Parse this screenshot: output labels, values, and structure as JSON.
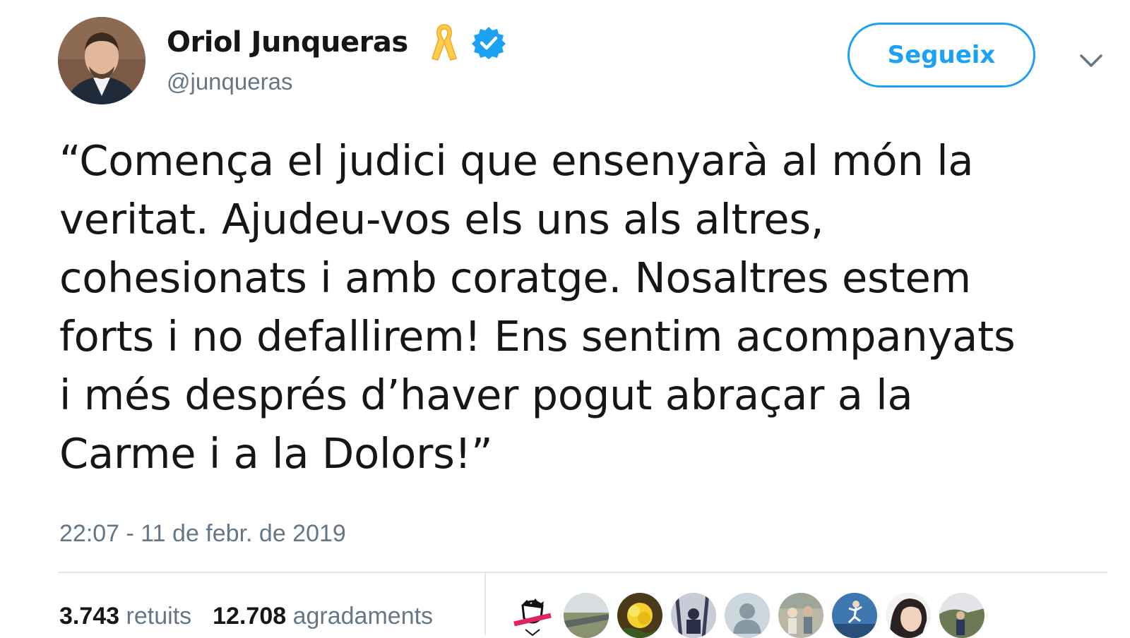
{
  "author": {
    "display_name": "Oriol Junqueras",
    "handle": "@junqueras",
    "verified": true,
    "avatar_icon": "user-avatar",
    "ribbon_icon": "yellow-ribbon-icon"
  },
  "follow_button": {
    "label": "Segueix"
  },
  "menu": {
    "icon": "chevron-down-icon"
  },
  "tweet": {
    "text": "“Comença el judici que ensenyarà al món la\nveritat. Ajudeu-vos els uns als altres,\ncohesionats i amb coratge. Nosaltres estem\nforts i no defallirem! Ens sentim acompanyats\ni més després d’haver pogut abraçar a la\nCarme i a la Dolors!”",
    "timestamp": "22:07 - 11 de febr. de 2019"
  },
  "stats": {
    "retweets_count": "3.743",
    "retweets_label": "retuits",
    "likes_count": "12.708",
    "likes_label": "agradaments"
  },
  "colors": {
    "accent": "#1da1f2",
    "text": "#14171a",
    "secondary": "#657786",
    "divider": "#e1e8ed",
    "ribbon": "#ffcc4d"
  },
  "likers": [
    {
      "icon": "sketch-face-avatar"
    },
    {
      "icon": "road-landscape-avatar"
    },
    {
      "icon": "yellow-flower-avatar"
    },
    {
      "icon": "snow-person-avatar"
    },
    {
      "icon": "default-profile-avatar"
    },
    {
      "icon": "group-photo-avatar"
    },
    {
      "icon": "jumping-person-avatar"
    },
    {
      "icon": "face-photo-avatar"
    },
    {
      "icon": "street-person-avatar"
    }
  ]
}
